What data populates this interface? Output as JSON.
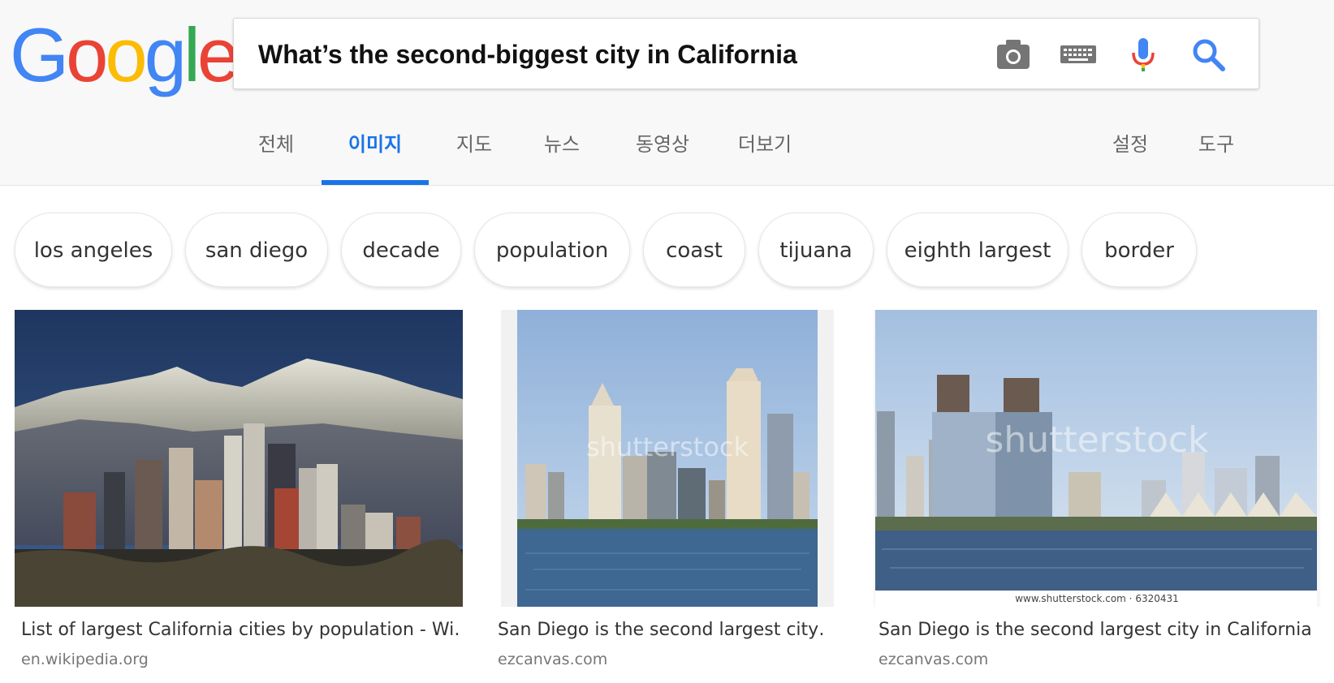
{
  "logo": {
    "letters": [
      "G",
      "o",
      "o",
      "g",
      "l",
      "e"
    ]
  },
  "search": {
    "query": "What’s the second-biggest city in California"
  },
  "search_icons": [
    "camera-icon",
    "keyboard-icon",
    "microphone-icon",
    "search-icon"
  ],
  "tabs": [
    {
      "label": "전체",
      "active": false
    },
    {
      "label": "이미지",
      "active": true
    },
    {
      "label": "지도",
      "active": false
    },
    {
      "label": "뉴스",
      "active": false
    },
    {
      "label": "동영상",
      "active": false
    },
    {
      "label": "더보기",
      "active": false
    }
  ],
  "tools": [
    {
      "label": "설정"
    },
    {
      "label": "도구"
    }
  ],
  "chips": [
    "los angeles",
    "san diego",
    "decade",
    "population",
    "coast",
    "tijuana",
    "eighth largest",
    "border"
  ],
  "results": [
    {
      "caption": "List of largest California cities by population - Wi…",
      "domain": "en.wikipedia.org"
    },
    {
      "caption": "San Diego is the second largest city…",
      "domain": "ezcanvas.com",
      "watermark": "shutterstock"
    },
    {
      "caption": "San Diego is the second largest city in California a…",
      "domain": "ezcanvas.com",
      "watermark": "shutterstock",
      "image_footer": "www.shutterstock.com · 6320431"
    }
  ],
  "colors": {
    "accent": "#1a73e8",
    "google_blue": "#4285F4",
    "google_red": "#EA4335",
    "google_yellow": "#FBBC05",
    "google_green": "#34A853"
  }
}
